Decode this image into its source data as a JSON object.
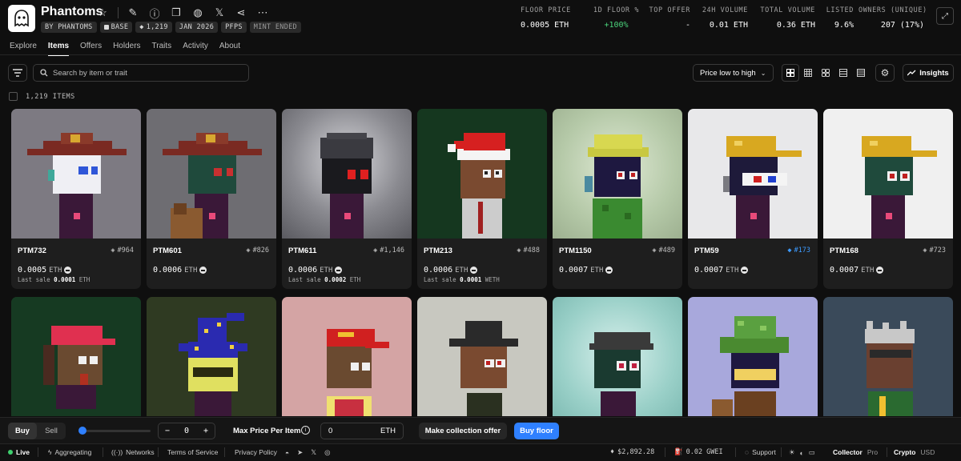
{
  "collection": {
    "name": "Phantoms",
    "chips": [
      "BY PHANTOMS",
      "BASE",
      "1,219",
      "JAN 2026",
      "PFPS",
      "MINT ENDED"
    ]
  },
  "stats": [
    {
      "label": "FLOOR PRICE",
      "value": "0.0005 ETH"
    },
    {
      "label": "1D FLOOR %",
      "value": "+100%",
      "color": "#4ad17a"
    },
    {
      "label": "TOP OFFER",
      "value": "-"
    },
    {
      "label": "24H VOLUME",
      "value": "0.01 ETH"
    },
    {
      "label": "TOTAL VOLUME",
      "value": "0.36 ETH"
    },
    {
      "label": "LISTED",
      "value": "9.6%"
    },
    {
      "label": "OWNERS (UNIQUE)",
      "value": "207 (17%)"
    }
  ],
  "tabs": [
    "Explore",
    "Items",
    "Offers",
    "Holders",
    "Traits",
    "Activity",
    "About"
  ],
  "active_tab": "Items",
  "search": {
    "placeholder": "Search by item or trait"
  },
  "sort": {
    "label": "Price low to high"
  },
  "insights_label": "Insights",
  "items_count": "1,219 ITEMS",
  "items": [
    {
      "name": "PTM732",
      "rank": "#964",
      "price": "0.0005",
      "unit": "ETH",
      "last_sale_label": "Last sale",
      "last_sale_value": "0.0001",
      "last_sale_unit": "ETH"
    },
    {
      "name": "PTM601",
      "rank": "#826",
      "price": "0.0006",
      "unit": "ETH"
    },
    {
      "name": "PTM611",
      "rank": "#1,146",
      "price": "0.0006",
      "unit": "ETH",
      "last_sale_label": "Last sale",
      "last_sale_value": "0.0002",
      "last_sale_unit": "ETH"
    },
    {
      "name": "PTM213",
      "rank": "#488",
      "price": "0.0006",
      "unit": "ETH",
      "last_sale_label": "Last sale",
      "last_sale_value": "0.0001",
      "last_sale_unit": "WETH"
    },
    {
      "name": "PTM1150",
      "rank": "#489",
      "price": "0.0007",
      "unit": "ETH"
    },
    {
      "name": "PTM59",
      "rank": "#173",
      "price": "0.0007",
      "unit": "ETH",
      "rank_color": "#3d9bff"
    },
    {
      "name": "PTM168",
      "rank": "#723",
      "price": "0.0007",
      "unit": "ETH"
    }
  ],
  "action_bar": {
    "buy": "Buy",
    "sell": "Sell",
    "quantity": "0",
    "max_price_label": "Max Price Per Item",
    "max_price_value": "0",
    "max_price_unit": "ETH",
    "collection_offer": "Make collection offer",
    "buy_floor": "Buy floor"
  },
  "status_bar": {
    "live": "Live",
    "aggregating": "Aggregating",
    "networks": "Networks",
    "terms": "Terms of Service",
    "privacy": "Privacy Policy",
    "eth_price": "$2,892.28",
    "gas": "0.02 GWEI",
    "support": "Support",
    "mode_collector": "Collector",
    "mode_pro": "Pro",
    "currency_crypto": "Crypto",
    "currency_usd": "USD"
  },
  "colors": {
    "accent": "#2f80ff",
    "positive": "#4ad17a",
    "background": "#0f0f0f",
    "card": "#1e1e1e"
  }
}
